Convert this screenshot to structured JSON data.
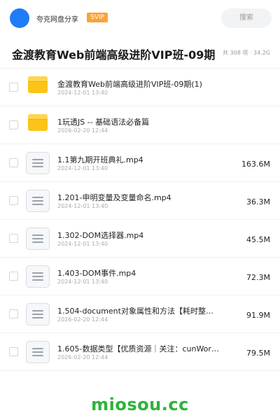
{
  "header": {
    "share_label": "夸克网盘分享",
    "badge": "SVIP",
    "search_label": "搜索"
  },
  "title": {
    "text": "金渡教育Web前端高级进阶VIP班-09期",
    "summary": "共 308 项 · 34.2G"
  },
  "files": [
    {
      "type": "folder",
      "icon": "folder-icon",
      "name": "金渡教育Web前端高级进阶VIP班-09期(1)",
      "date": "2024-12-01 13:40",
      "size": ""
    },
    {
      "type": "folder",
      "icon": "folder-icon",
      "name": "1玩透JS -- 基础语法必备篇",
      "date": "2026-02-20 12:44",
      "size": ""
    },
    {
      "type": "file",
      "icon": "file-icon",
      "name": "1.1第九期开班典礼.mp4",
      "date": "2024-12-01 13:40",
      "size": "163.6M"
    },
    {
      "type": "file",
      "icon": "file-icon",
      "name": "1.201-申明变量及变量命名.mp4",
      "date": "2024-12-01 13:40",
      "size": "36.3M"
    },
    {
      "type": "file",
      "icon": "file-icon",
      "name": "1.302-DOM选择器.mp4",
      "date": "2024-12-01 13:40",
      "size": "45.5M"
    },
    {
      "type": "file",
      "icon": "file-icon",
      "name": "1.403-DOM事件.mp4",
      "date": "2024-12-01 13:40",
      "size": "72.3M"
    },
    {
      "type": "file",
      "icon": "file-icon",
      "name": "1.504-document对象属性和方法【耗时整…",
      "date": "2026-02-20 12:44",
      "size": "91.9M"
    },
    {
      "type": "file",
      "icon": "file-icon",
      "name": "1.605-数据类型【优质资源｜关注：cunWor…",
      "date": "2026-02-20 12:44",
      "size": "79.5M"
    }
  ],
  "footer": {
    "watermark": "miosou.cc"
  },
  "colors": {
    "avatar": "#1f7cf5",
    "badge": "#f8a33a",
    "folder": "#fcc419",
    "watermark": "#2db33a"
  }
}
